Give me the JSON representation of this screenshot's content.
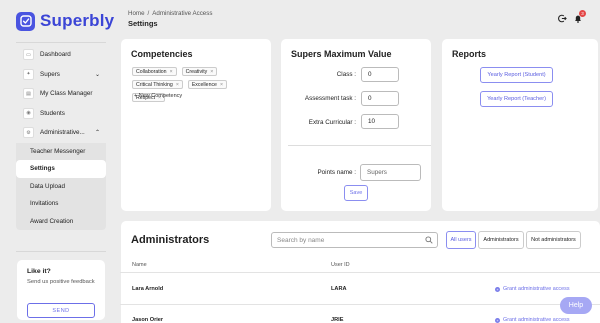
{
  "app": {
    "name": "Superbly",
    "brand_color": "#3b45d6",
    "accent_color": "#6c6fe8"
  },
  "breadcrumb": {
    "home": "Home",
    "separator": "/",
    "current": "Administrative Access"
  },
  "page": {
    "title": "Settings"
  },
  "header": {
    "notification_count": "3",
    "icons": [
      "logout-icon",
      "bell-icon"
    ]
  },
  "sidebar": {
    "items": [
      {
        "label": "Dashboard",
        "icon": "dashboard-icon"
      },
      {
        "label": "Supers",
        "icon": "star-icon",
        "chevron": "⌄"
      },
      {
        "label": "My Class Manager",
        "icon": "clipboard-icon"
      },
      {
        "label": "Students",
        "icon": "students-icon"
      },
      {
        "label": "Administrative...",
        "icon": "gear-icon",
        "chevron": "⌃"
      }
    ],
    "sub_items": [
      {
        "label": "Teacher Messenger",
        "active": false
      },
      {
        "label": "Settings",
        "active": true
      },
      {
        "label": "Data Upload",
        "active": false
      },
      {
        "label": "Invitations",
        "active": false
      },
      {
        "label": "Award Creation",
        "active": false
      }
    ]
  },
  "feedback": {
    "title": "Like it?",
    "subtitle": "Send us positive feedback",
    "button": "SEND"
  },
  "competencies": {
    "title": "Competencies",
    "chips": [
      "Collaboration",
      "Creativity",
      "Critical Thinking",
      "Excellence",
      "Respect"
    ],
    "remove_glyph": "×",
    "new_label": "+ New Competency"
  },
  "supers_max": {
    "title": "Supers Maximum Value",
    "fields": [
      {
        "label": "Class :",
        "value": "0"
      },
      {
        "label": "Assessment task :",
        "value": "0"
      },
      {
        "label": "Extra Curricular :",
        "value": "10"
      }
    ],
    "points_label": "Points name :",
    "points_value": "Supers",
    "save": "Save"
  },
  "reports": {
    "title": "Reports",
    "buttons": [
      "Yearly Report (Student)",
      "Yearly Report (Teacher)"
    ]
  },
  "administrators": {
    "title": "Administrators",
    "search_placeholder": "Search by name",
    "filters": [
      "All users",
      "Administrators",
      "Not administrators"
    ],
    "active_filter": "All users",
    "columns": [
      "Name",
      "User ID"
    ],
    "rows": [
      {
        "name": "Lara Arnold",
        "user_id": "LARA",
        "action": "Grant administrative access"
      },
      {
        "name": "Jason Orier",
        "user_id": "JRIE",
        "action": "Grant administrative access"
      }
    ]
  },
  "help": {
    "label": "Help"
  }
}
